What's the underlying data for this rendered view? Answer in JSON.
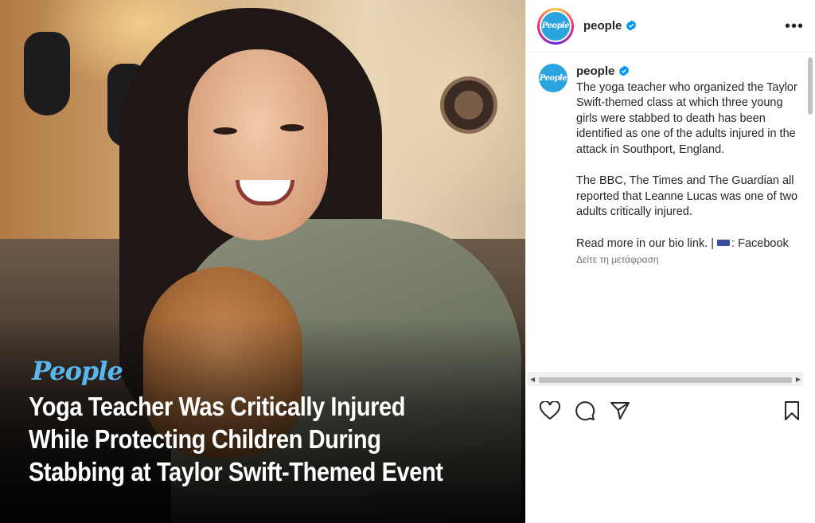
{
  "post": {
    "image": {
      "brand": "People",
      "headline": "Yoga Teacher Was Critically Injured While Protecting Children During Stabbing at Taylor Swift-Themed Event"
    }
  },
  "header": {
    "username": "people",
    "avatar_text": "People",
    "more_label": "•••"
  },
  "caption": {
    "username": "people",
    "avatar_text": "People",
    "paragraph1": "The yoga teacher who organized the Taylor Swift-themed class at which three young girls were stabbed to death has been identified as one of the adults injured in the attack in Southport, England.",
    "paragraph2": "The BBC, The Times and The Guardian all reported that Leanne Lucas was one of two adults critically injured.",
    "paragraph3_start": "Read more in our bio link. |",
    "paragraph3_end": ": Facebook",
    "translate": "Δείτε τη μετάφραση"
  },
  "icons": {
    "like": "heart-icon",
    "comment": "comment-icon",
    "share": "share-icon",
    "save": "bookmark-icon",
    "verified": "verified-badge-icon",
    "more": "more-options-icon"
  },
  "colors": {
    "verified": "#0095f6",
    "brand": "#5ab7ee",
    "avatar_bg": "#2aa4dc"
  }
}
